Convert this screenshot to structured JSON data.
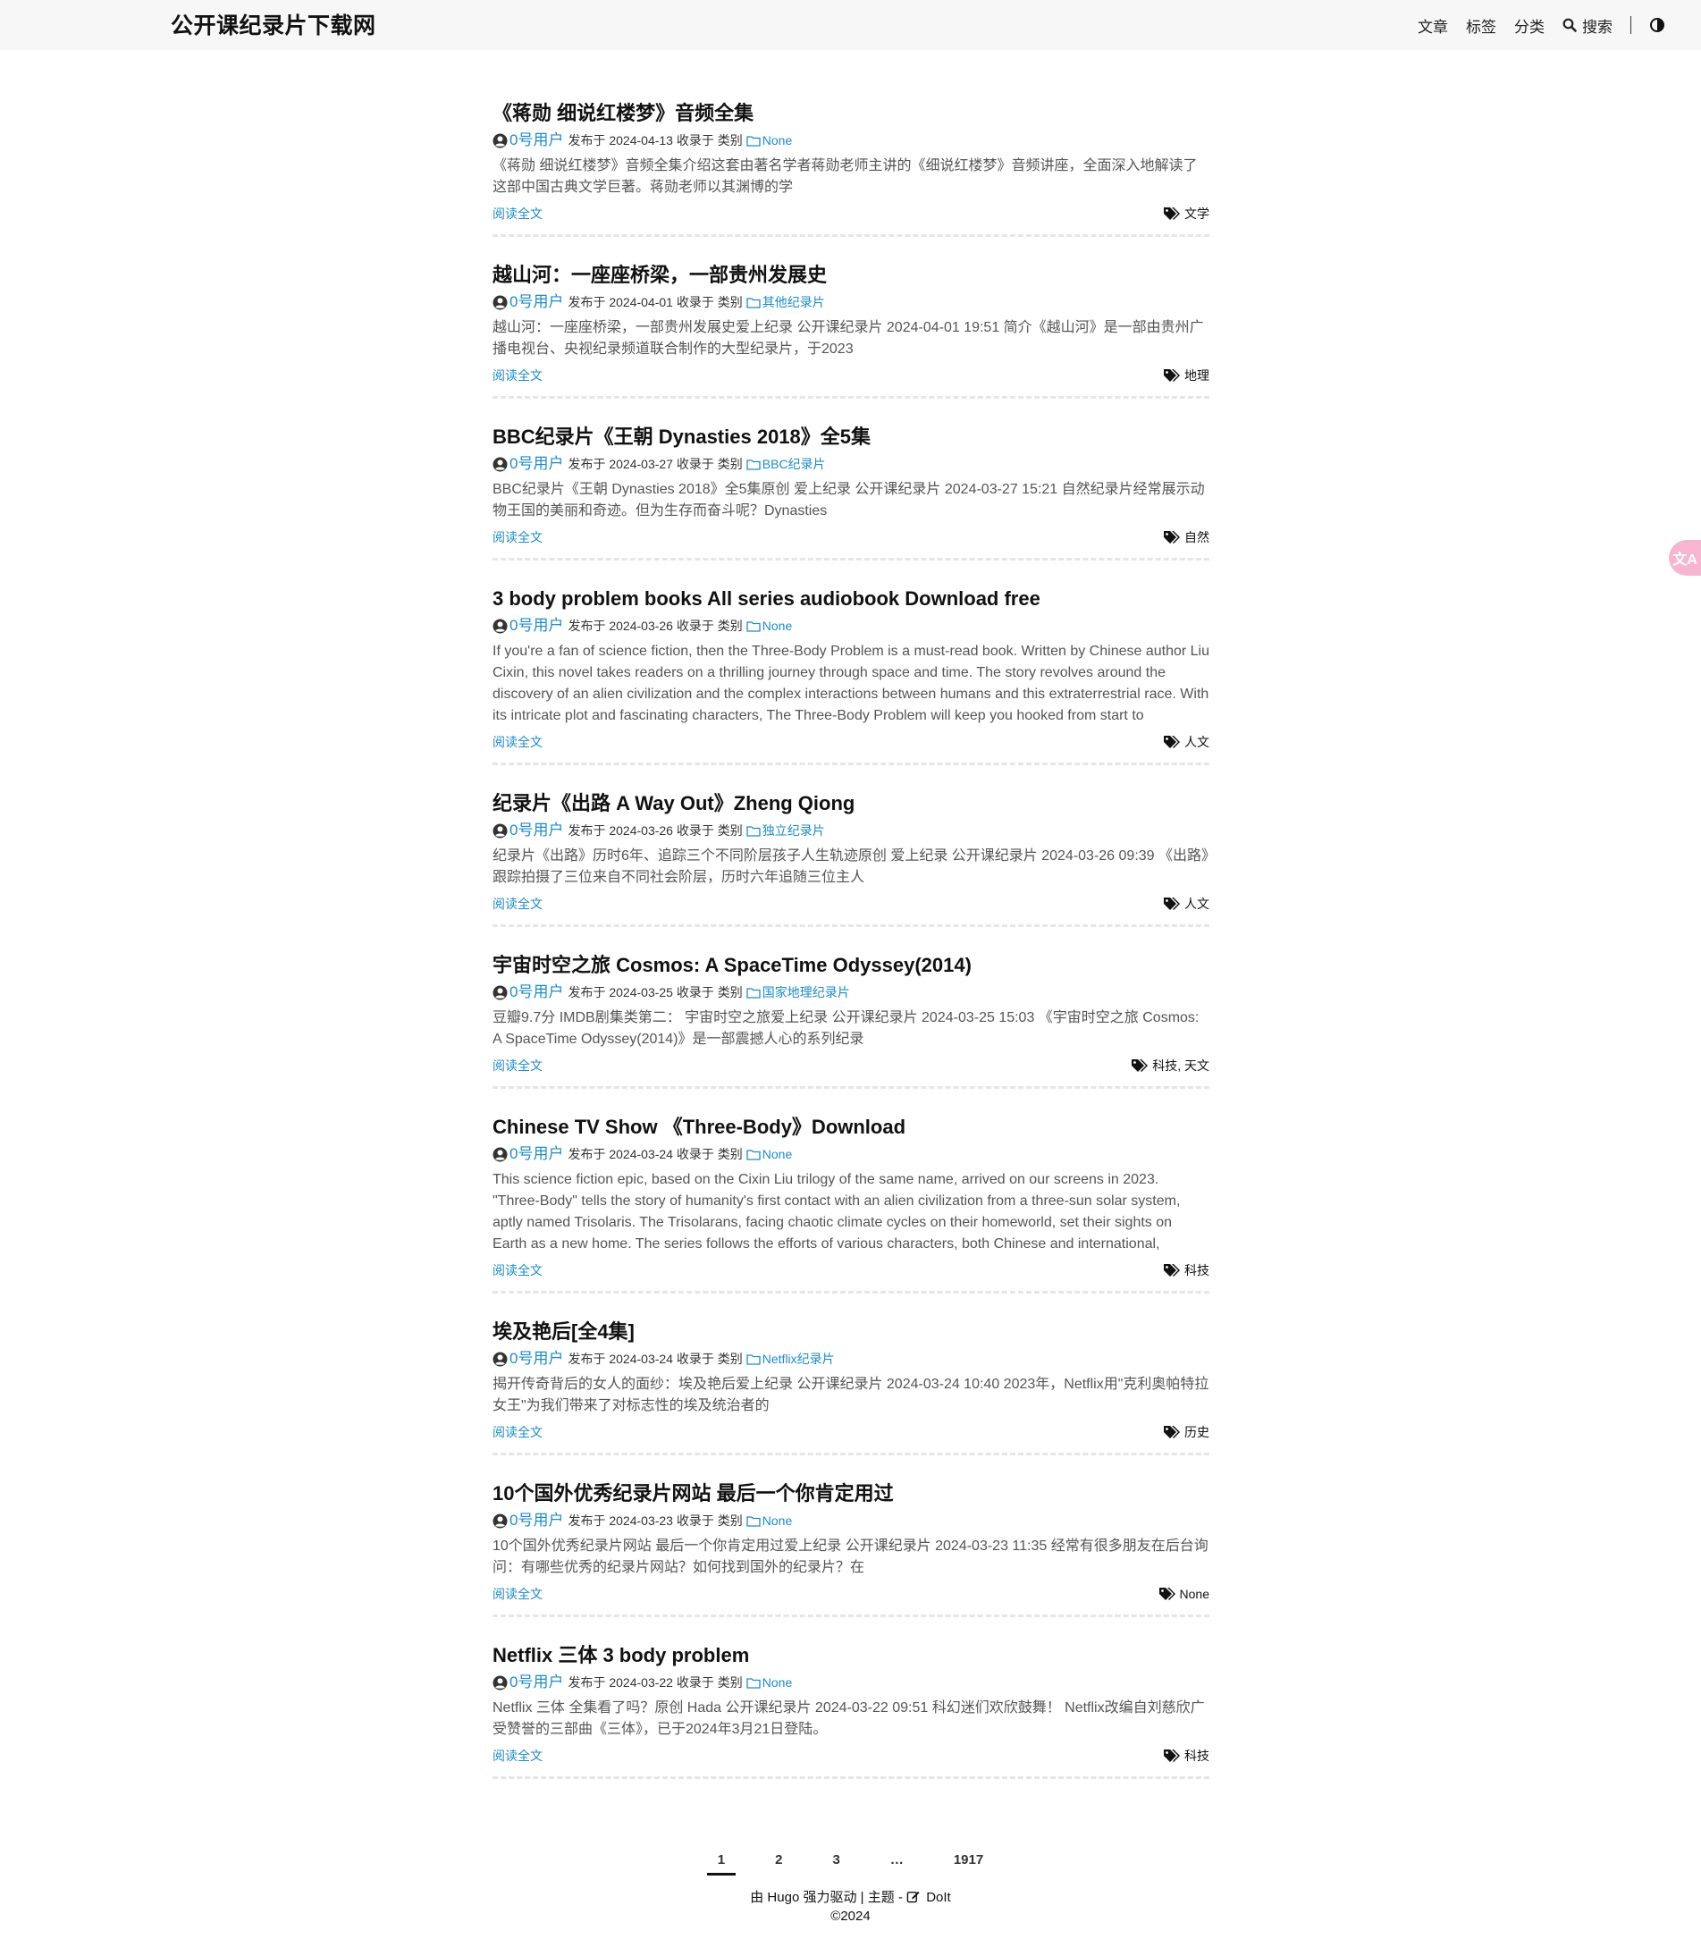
{
  "header": {
    "site_title": "公开课纪录片下载网",
    "nav": {
      "articles": "文章",
      "tags": "标签",
      "categories": "分类",
      "search": "搜索"
    }
  },
  "labels": {
    "published_on": "发布于",
    "collected_in": "收录于 类别",
    "read_more": "阅读全文"
  },
  "posts": [
    {
      "title": "《蒋勋 细说红楼梦》音频全集",
      "author": "0号用户",
      "date": "2024-04-13",
      "category": "None",
      "summary": "《蒋勋 细说红楼梦》音频全集介绍这套由著名学者蒋勋老师主讲的《细说红楼梦》音频讲座，全面深入地解读了这部中国古典文学巨著。蒋勋老师以其渊博的学",
      "tags": "文学"
    },
    {
      "title": "越山河：一座座桥梁，一部贵州发展史",
      "author": "0号用户",
      "date": "2024-04-01",
      "category": "其他纪录片",
      "summary": "越山河：一座座桥梁，一部贵州发展史爱上纪录 公开课纪录片 2024-04-01 19:51 简介《越山河》是一部由贵州广播电视台、央视纪录频道联合制作的大型纪录片，于2023",
      "tags": "地理"
    },
    {
      "title": "BBC纪录片《王朝 Dynasties 2018》全5集",
      "author": "0号用户",
      "date": "2024-03-27",
      "category": "BBC纪录片",
      "summary": "BBC纪录片《王朝 Dynasties 2018》全5集原创 爱上纪录 公开课纪录片 2024-03-27 15:21 自然纪录片经常展示动物王国的美丽和奇迹。但为生存而奋斗呢？Dynasties",
      "tags": "自然"
    },
    {
      "title": "3 body problem books All series audiobook Download free",
      "author": "0号用户",
      "date": "2024-03-26",
      "category": "None",
      "summary": "If you're a fan of science fiction, then the Three-Body Problem is a must-read book. Written by Chinese author Liu Cixin, this novel takes readers on a thrilling journey through space and time. The story revolves around the discovery of an alien civilization and the complex interactions between humans and this extraterrestrial race. With its intricate plot and fascinating characters, The Three-Body Problem will keep you hooked from start to",
      "tags": "人文"
    },
    {
      "title": "纪录片《出路 A Way Out》Zheng Qiong",
      "author": "0号用户",
      "date": "2024-03-26",
      "category": "独立纪录片",
      "summary": "纪录片《出路》历时6年、追踪三个不同阶层孩子人生轨迹原创 爱上纪录 公开课纪录片 2024-03-26 09:39 《出路》跟踪拍摄了三位来自不同社会阶层，历时六年追随三位主人",
      "tags": "人文"
    },
    {
      "title": "宇宙时空之旅 Cosmos: A SpaceTime Odyssey(2014)",
      "author": "0号用户",
      "date": "2024-03-25",
      "category": "国家地理纪录片",
      "summary": "豆瓣9.7分 IMDB剧集类第二： 宇宙时空之旅爱上纪录 公开课纪录片 2024-03-25 15:03 《宇宙时空之旅 Cosmos: A SpaceTime Odyssey(2014)》是一部震撼人心的系列纪录",
      "tags": "科技, 天文"
    },
    {
      "title": "Chinese TV Show 《Three-Body》Download",
      "author": "0号用户",
      "date": "2024-03-24",
      "category": "None",
      "summary": "This science fiction epic, based on the Cixin Liu trilogy of the same name, arrived on our screens in 2023. \"Three-Body\" tells the story of humanity's first contact with an alien civilization from a three-sun solar system, aptly named Trisolaris. The Trisolarans, facing chaotic climate cycles on their homeworld, set their sights on Earth as a new home. The series follows the efforts of various characters, both Chinese and international,",
      "tags": "科技"
    },
    {
      "title": "埃及艳后[全4集]",
      "author": "0号用户",
      "date": "2024-03-24",
      "category": "Netflix纪录片",
      "summary": "揭开传奇背后的女人的面纱：埃及艳后爱上纪录 公开课纪录片 2024-03-24 10:40 2023年，Netflix用\"克利奥帕特拉女王\"为我们带来了对标志性的埃及统治者的",
      "tags": "历史"
    },
    {
      "title": "10个国外优秀纪录片网站 最后一个你肯定用过",
      "author": "0号用户",
      "date": "2024-03-23",
      "category": "None",
      "summary": "10个国外优秀纪录片网站 最后一个你肯定用过爱上纪录 公开课纪录片 2024-03-23 11:35 经常有很多朋友在后台询问：有哪些优秀的纪录片网站？如何找到国外的纪录片？在",
      "tags": "None"
    },
    {
      "title": "Netflix 三体 3 body problem",
      "author": "0号用户",
      "date": "2024-03-22",
      "category": "None",
      "summary": "Netflix 三体 全集看了吗？原创 Hada 公开课纪录片 2024-03-22 09:51 科幻迷们欢欣鼓舞！ Netflix改编自刘慈欣广受赞誉的三部曲《三体》，已于2024年3月21日登陆。",
      "tags": "科技"
    }
  ],
  "pagination": {
    "pages": [
      "1",
      "2",
      "3",
      "…",
      "1917"
    ],
    "active": "1"
  },
  "footer": {
    "powered": "由 Hugo 强力驱动 | 主题 -",
    "theme_name": "DoIt",
    "copyright": "©2024"
  },
  "float_button": {
    "icon": "translate-icon",
    "glyph": "文A"
  },
  "colors": {
    "link": "#1f8bc8",
    "header_bg": "#f7f7f7",
    "float_bg": "#f7b6cf"
  }
}
